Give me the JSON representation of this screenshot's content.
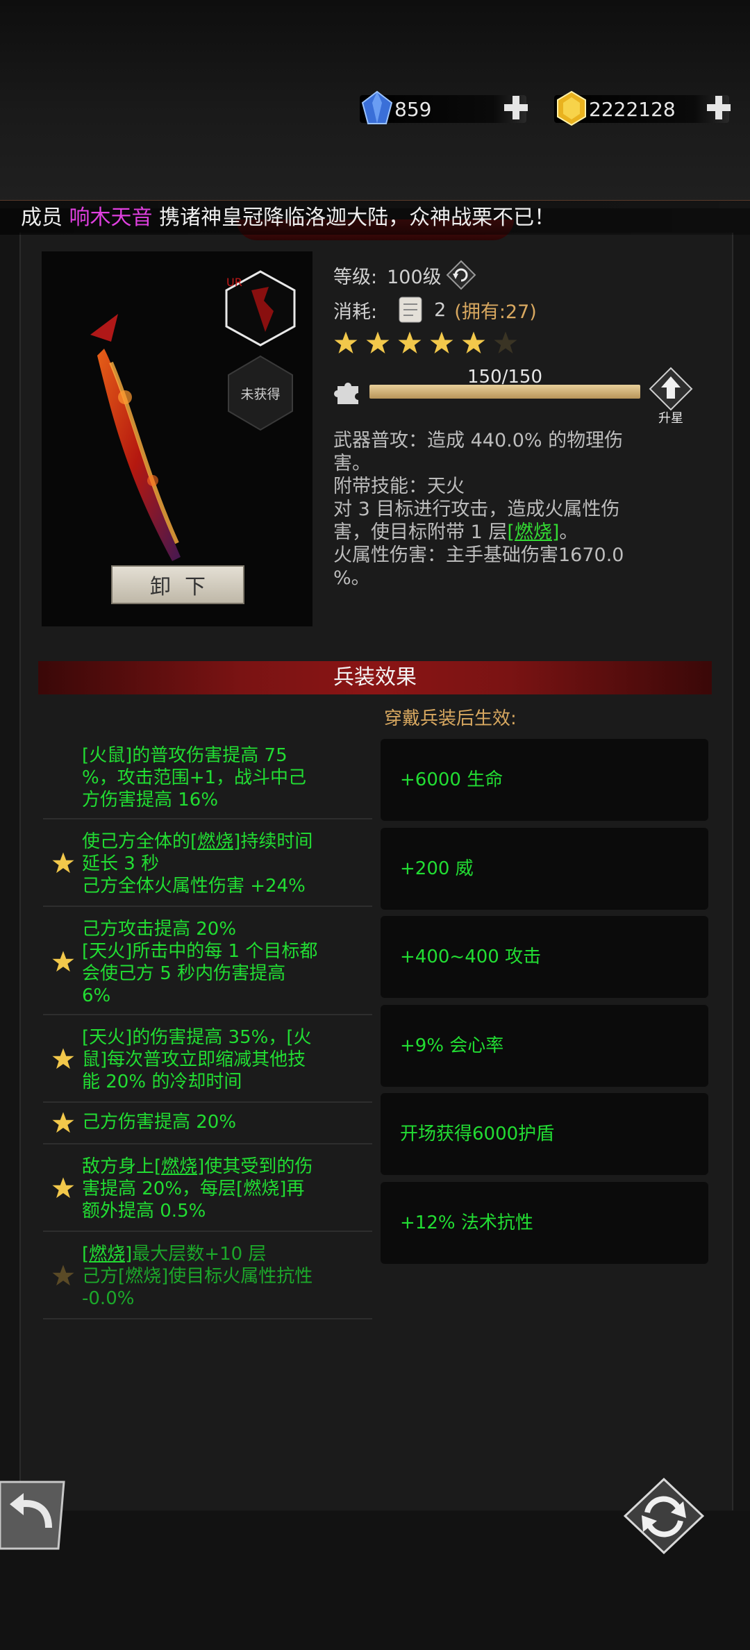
{
  "currencies": [
    {
      "icon": "blue-diamond-icon",
      "value": "859"
    },
    {
      "icon": "gold-gem-icon",
      "value": "2222128"
    }
  ],
  "marquee": {
    "prefix": "成员",
    "name": "响木天音",
    "suffix": "携诸神皇冠降临洛迦大陆，众神战栗不已！"
  },
  "weapon": {
    "rarity": "UR",
    "unobtained_label": "未获得",
    "unequip_label": "卸下"
  },
  "info": {
    "level_label": "等级:",
    "level_value": "100级",
    "cost_label": "消耗:",
    "cost_count": "2",
    "cost_owned": "(拥有:27)",
    "stars_filled": 5,
    "stars_total": 6,
    "progress_text": "150/150",
    "progress_fraction": 1.0,
    "upgrade_label": "升星"
  },
  "description": {
    "line1": "武器普攻：造成 440.0% 的物理伤",
    "line2": "害。",
    "line3": "附带技能：天火",
    "line4": "对 3 目标进行攻击，造成火属性伤",
    "line5_pre": "害，使目标附带 1 层",
    "line5_link": "[燃烧]",
    "line5_post": "。",
    "line6": "火属性伤害：主手基础伤害1670.0",
    "line7": "%。"
  },
  "section_title": "兵装效果",
  "sub_title": "穿戴兵装后生效:",
  "effects": [
    {
      "l1": "[火鼠]的普攻伤害提高 75",
      "l2": "%，攻击范围+1，战斗中己",
      "l3": "方伤害提高 16%"
    },
    {
      "l1_link": "[燃烧]",
      "l1_pre": "使己方全体的",
      "l1_post": "持续时间",
      "l2": "延长 3 秒",
      "l3": "己方全体火属性伤害 +24%"
    },
    {
      "l1": "己方攻击提高 20%",
      "l2": "[天火]所击中的每 1 个目标都",
      "l3": "会使己方 5 秒内伤害提高",
      "l4": "6%"
    },
    {
      "l1": "[天火]的伤害提高 35%，[火",
      "l2": "鼠]每次普攻立即缩减其他技",
      "l3": "能 20% 的冷却时间"
    },
    {
      "l1": "己方伤害提高 20%"
    },
    {
      "l1_pre": "敌方身上",
      "l1_link": "[燃烧]",
      "l1_post": "使其受到的伤",
      "l2": "害提高 20%，每层[燃烧]再",
      "l3": "额外提高 0.5%"
    },
    {
      "l1_link": "[燃烧]",
      "l1_post": "最大层数+10 层",
      "l2": "己方[燃烧]使目标火属性抗性",
      "l3": "-0.0%"
    }
  ],
  "bonuses": [
    "+6000 生命",
    "+200 威",
    "+400~400 攻击",
    "+9% 会心率",
    "开场获得6000护盾",
    "+12% 法术抗性"
  ],
  "colors": {
    "effect_green": "#22dd33",
    "gold": "#d8a860",
    "header_red": "#8a1515"
  }
}
